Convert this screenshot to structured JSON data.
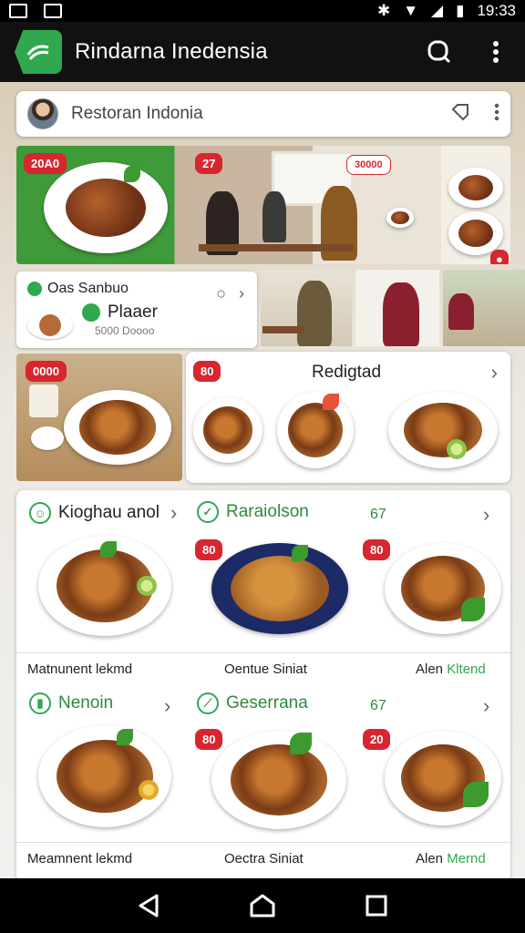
{
  "status_bar": {
    "time": "19:33"
  },
  "app_bar": {
    "title": "Rindarna Inedensia"
  },
  "search": {
    "text": "Restoran Indonia"
  },
  "hero": {
    "badge_left": "20A0",
    "badge_mid": "27",
    "badge_right": "30000"
  },
  "promo": {
    "title": "Oas Sanbuo",
    "subtitle": "Plaaer",
    "caption": "5000 Doooo"
  },
  "recommended": {
    "badge": "80",
    "title": "Redigtad",
    "photo_badge": "0000"
  },
  "menu": {
    "categories": [
      {
        "label": "Kioghau anol",
        "count": ""
      },
      {
        "label": "Raraiolson",
        "count": "67"
      },
      {
        "label": "Nenoin",
        "count": ""
      },
      {
        "label": "Geserrana",
        "count": "67"
      }
    ],
    "row1_badges": [
      "80",
      "80"
    ],
    "row2_badges": [
      "80",
      "20"
    ],
    "row1_labels": {
      "a": "Matnunent lekmd",
      "b": "Oentue Siniat",
      "c_plain": "Alen ",
      "c_green": "Kltend"
    },
    "row2_labels": {
      "a": "Meamnent lekmd",
      "b": "Oectra Siniat",
      "c_plain": "Alen ",
      "c_green": "Mernd"
    }
  },
  "colors": {
    "brand": "#2fa84f",
    "badge": "#d7262f",
    "appbar": "#111111"
  }
}
